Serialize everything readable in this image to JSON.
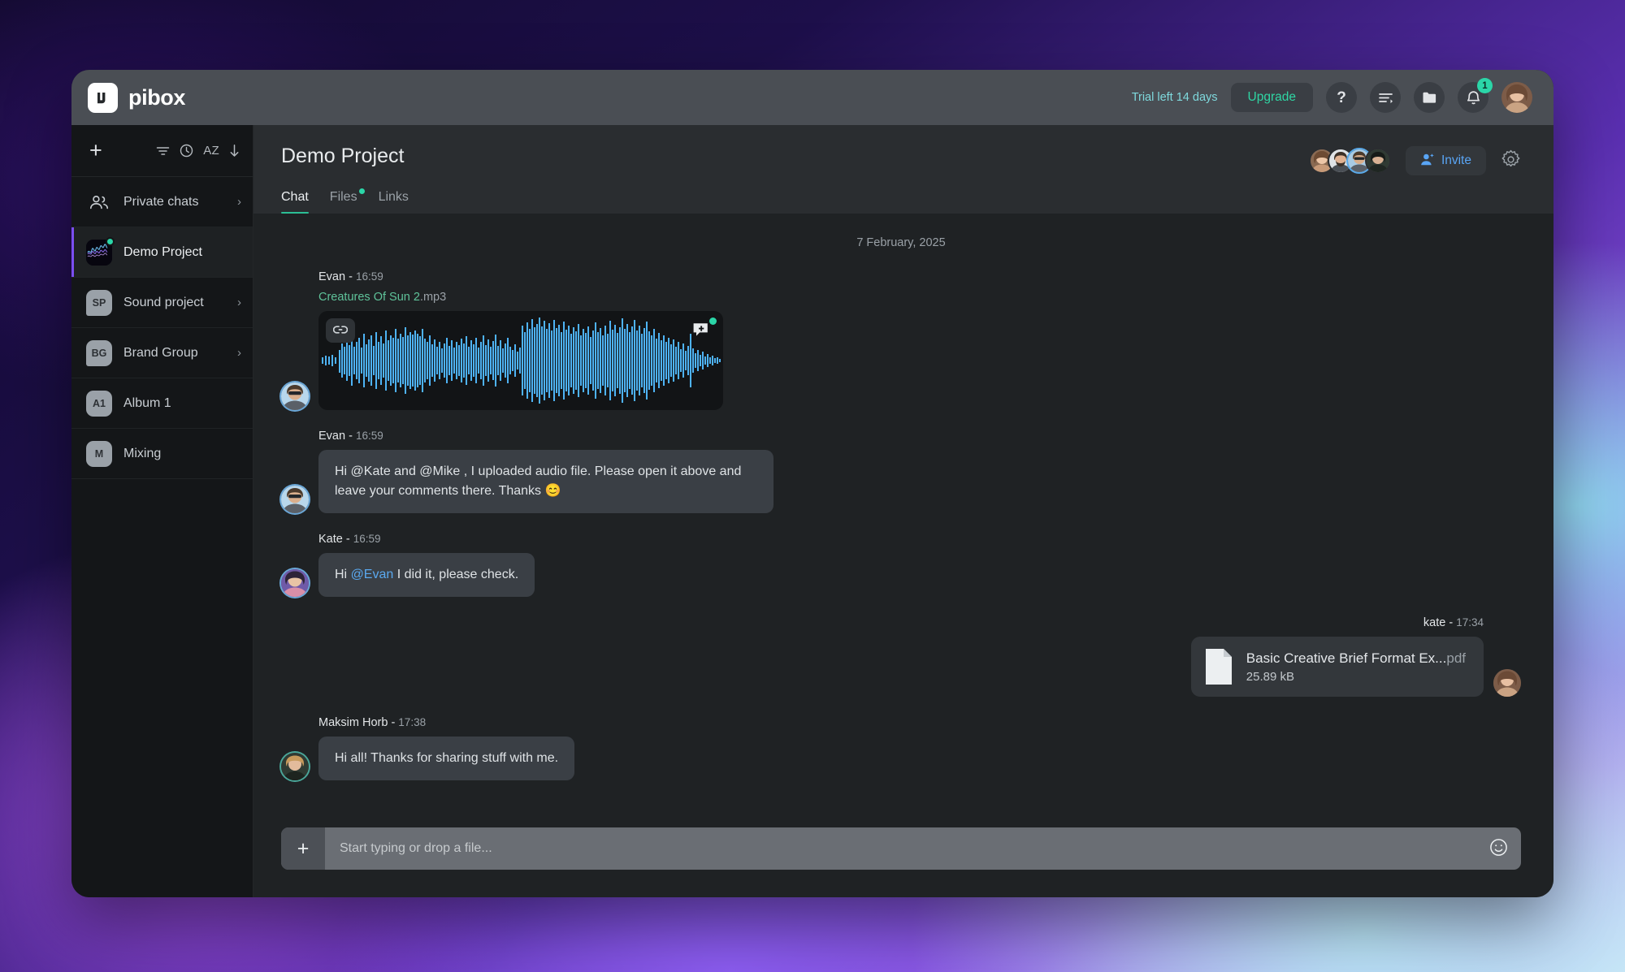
{
  "app": {
    "brand_name": "pibox",
    "logo_icon": "pibox-logo-icon"
  },
  "topbar": {
    "trial_text": "Trial left 14 days",
    "upgrade_label": "Upgrade",
    "help_label": "?",
    "tasks_icon": "tasks-list-icon",
    "folder_icon": "folder-icon",
    "bell_icon": "bell-icon",
    "notification_count": "1",
    "account_avatar": "user-avatar"
  },
  "sidebar": {
    "add_label": "+",
    "tools": {
      "filter_icon": "filter-icon",
      "recent_icon": "clock-icon",
      "sort_alpha_label": "AZ",
      "sort_dir_icon": "arrow-down-icon"
    },
    "items": [
      {
        "label": "Private chats",
        "icon": "people-icon",
        "type": "people",
        "chevron": "›",
        "active": false
      },
      {
        "label": "Demo Project",
        "icon": "waveform-thumb",
        "type": "thumb",
        "chevron": "",
        "active": true,
        "online": true
      },
      {
        "label": "Sound project",
        "icon": "SP",
        "type": "initials",
        "chevron": "›",
        "active": false
      },
      {
        "label": "Brand Group",
        "icon": "BG",
        "type": "initials",
        "chevron": "›",
        "active": false
      },
      {
        "label": "Album 1",
        "icon": "A1",
        "type": "initials",
        "chevron": "",
        "active": false
      },
      {
        "label": "Mixing",
        "icon": "M",
        "type": "initials",
        "chevron": "",
        "active": false
      }
    ]
  },
  "project": {
    "title": "Demo Project",
    "invite_label": "Invite",
    "settings_icon": "gear-icon",
    "member_count": 4,
    "tabs": [
      {
        "label": "Chat",
        "active": true,
        "dot": false
      },
      {
        "label": "Files",
        "active": false,
        "dot": true
      },
      {
        "label": "Links",
        "active": false,
        "dot": false
      }
    ]
  },
  "chat": {
    "date_separator": "7 February, 2025",
    "messages": [
      {
        "kind": "audio",
        "author": "Evan",
        "time": "16:59",
        "side": "left",
        "file_name": "Creatures Of Sun 2",
        "file_ext": ".mp3",
        "link_icon": "link-icon",
        "comment_icon": "add-comment-icon",
        "has_new_comment": true
      },
      {
        "kind": "text",
        "author": "Evan",
        "time": "16:59",
        "side": "left",
        "text": "Hi @Kate and @Mike , I uploaded audio file. Please open it above and leave your comments there. Thanks 😊"
      },
      {
        "kind": "text-mention",
        "author": "Kate",
        "time": "16:59",
        "side": "left",
        "text_before": "Hi ",
        "mention": "@Evan",
        "text_after": " I did it, please check."
      },
      {
        "kind": "file",
        "author": "kate",
        "time": "17:34",
        "side": "right",
        "file_name": "Basic Creative Brief Format Ex...",
        "file_ext": "pdf",
        "file_size": "25.89 kB",
        "file_icon": "document-icon"
      },
      {
        "kind": "text",
        "author": "Maksim Horb",
        "time": "17:38",
        "side": "left",
        "text": "Hi all! Thanks for sharing stuff with me."
      }
    ]
  },
  "composer": {
    "add_label": "+",
    "placeholder": "Start typing or drop a file...",
    "value": "",
    "emoji_icon": "smiley-icon"
  },
  "colors": {
    "accent_green": "#2bd6a8",
    "accent_blue": "#59a5f5",
    "waveform_blue": "#4eb3f5",
    "tab_underline": "#2bbf95",
    "sidebar_active_bar": "#7b4ef0",
    "topbar_bg": "#4a4e54",
    "window_bg": "#1f2224",
    "sidebar_bg": "#141618",
    "bubble_bg": "#3a3f45"
  }
}
